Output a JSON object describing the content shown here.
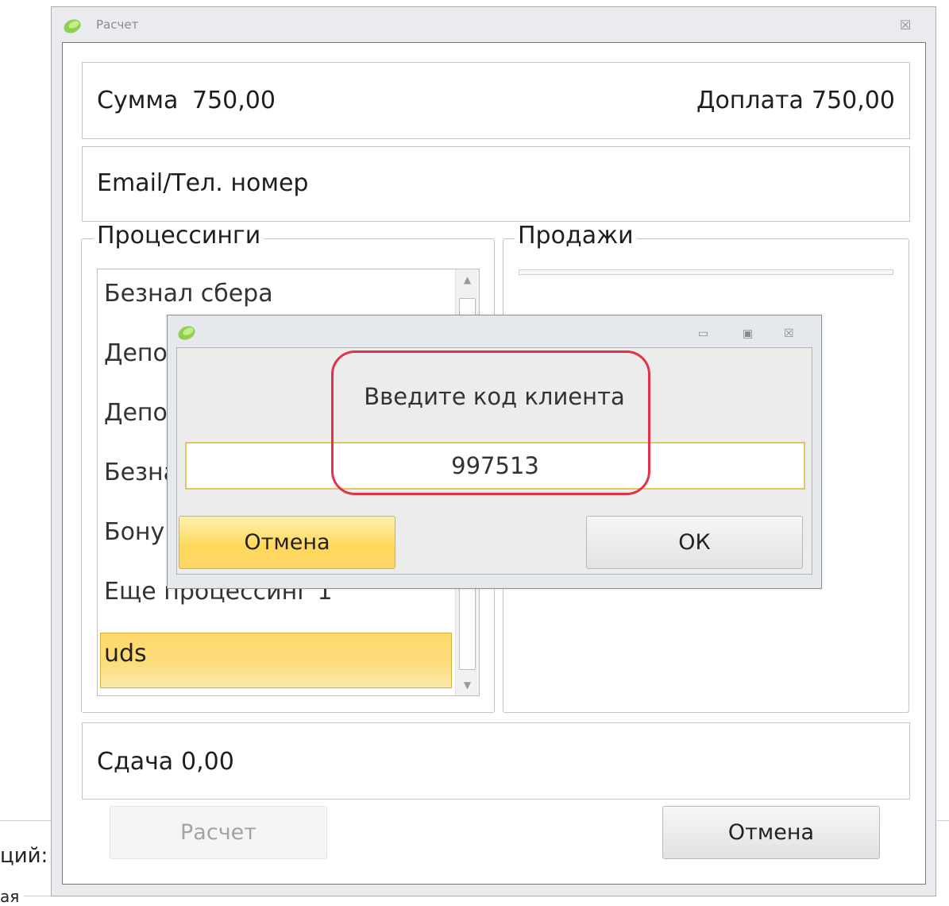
{
  "background": {
    "label_1": "ций:",
    "label_2": "ая"
  },
  "main_window": {
    "title": "Расчет",
    "close_glyph": "☒",
    "sum": {
      "label": "Сумма",
      "value": "750,00"
    },
    "surcharge": {
      "label": "Доплата",
      "value": "750,00"
    },
    "contact_label": "Email/Тел. номер",
    "processings": {
      "legend": "Процессинги",
      "items": [
        {
          "label": "Безнал сбера",
          "selected": false
        },
        {
          "label": "Депо",
          "selected": false
        },
        {
          "label": "Депо",
          "selected": false
        },
        {
          "label": "Безна",
          "selected": false
        },
        {
          "label": "Бону",
          "selected": false
        },
        {
          "label": "Еще процессинг 1",
          "selected": false
        },
        {
          "label": "uds",
          "selected": true
        }
      ]
    },
    "sales": {
      "legend": "Продажи"
    },
    "change": {
      "label": "Сдача",
      "value": "0,00"
    },
    "buttons": {
      "calculate": "Расчет",
      "cancel": "Отмена"
    }
  },
  "modal": {
    "prompt": "Введите код клиента",
    "code_value": "997513",
    "buttons": {
      "cancel": "Отмена",
      "ok": "ОК"
    },
    "controls": {
      "minimize": "▭",
      "maximize": "▣",
      "close": "☒"
    }
  },
  "colors": {
    "accent_yellow": "#ffd85a",
    "highlight_red": "#e2334a",
    "window_frame": "#e9ebee"
  }
}
